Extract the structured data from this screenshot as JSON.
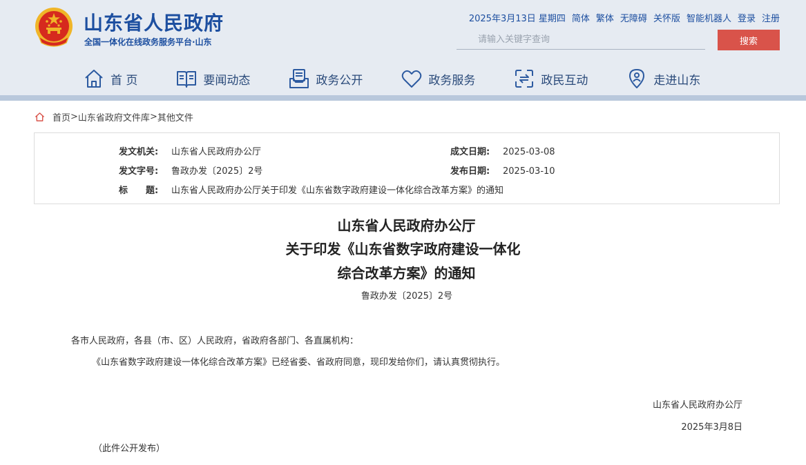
{
  "header": {
    "site_title": "山东省人民政府",
    "site_subtitle": "全国一体化在线政务服务平台·山东",
    "top_links": {
      "date": "2025年3月13日 星期四",
      "simplified": "简体",
      "traditional": "繁体",
      "accessibility": "无障碍",
      "elder_mode": "关怀版",
      "robot": "智能机器人",
      "login": "登录",
      "register": "注册"
    },
    "search": {
      "placeholder": "请输入关键字查询",
      "button_label": "搜索"
    },
    "nav": [
      {
        "label": "首 页",
        "icon": "home-icon"
      },
      {
        "label": "要闻动态",
        "icon": "book-icon"
      },
      {
        "label": "政务公开",
        "icon": "document-tray-icon"
      },
      {
        "label": "政务服务",
        "icon": "heart-icon"
      },
      {
        "label": "政民互动",
        "icon": "interaction-icon"
      },
      {
        "label": "走进山东",
        "icon": "location-person-icon"
      }
    ]
  },
  "breadcrumb": {
    "home": "首页",
    "sep1": ">",
    "library": "山东省政府文件库",
    "sep2": ">",
    "current": "其他文件"
  },
  "meta": {
    "issuer_label": "发文机关:",
    "issuer_value": "山东省人民政府办公厅",
    "date_created_label": "成文日期:",
    "date_created_value": "2025-03-08",
    "doc_no_label": "发文字号:",
    "doc_no_value": "鲁政办发〔2025〕2号",
    "date_published_label": "发布日期:",
    "date_published_value": "2025-03-10",
    "title_label": "标　　题:",
    "title_value": "山东省人民政府办公厅关于印发《山东省数字政府建设一体化综合改革方案》的通知"
  },
  "article": {
    "title_line1": "山东省人民政府办公厅",
    "title_line2": "关于印发《山东省数字政府建设一体化",
    "title_line3": "综合改革方案》的通知",
    "doc_no": "鲁政办发〔2025〕2号",
    "salutation": "各市人民政府，各县（市、区）人民政府，省政府各部门、各直属机构：",
    "body": "《山东省数字政府建设一体化综合改革方案》已经省委、省政府同意，现印发给你们，请认真贯彻执行。",
    "signer": "山东省人民政府办公厅",
    "sign_date": "2025年3月8日",
    "note": "（此件公开发布）"
  },
  "colors": {
    "brand_blue": "#1d4fa0",
    "header_bg": "#e6ebf2",
    "search_button": "#d9534a",
    "emblem_red": "#d62a1e",
    "emblem_gold": "#f0b528"
  }
}
